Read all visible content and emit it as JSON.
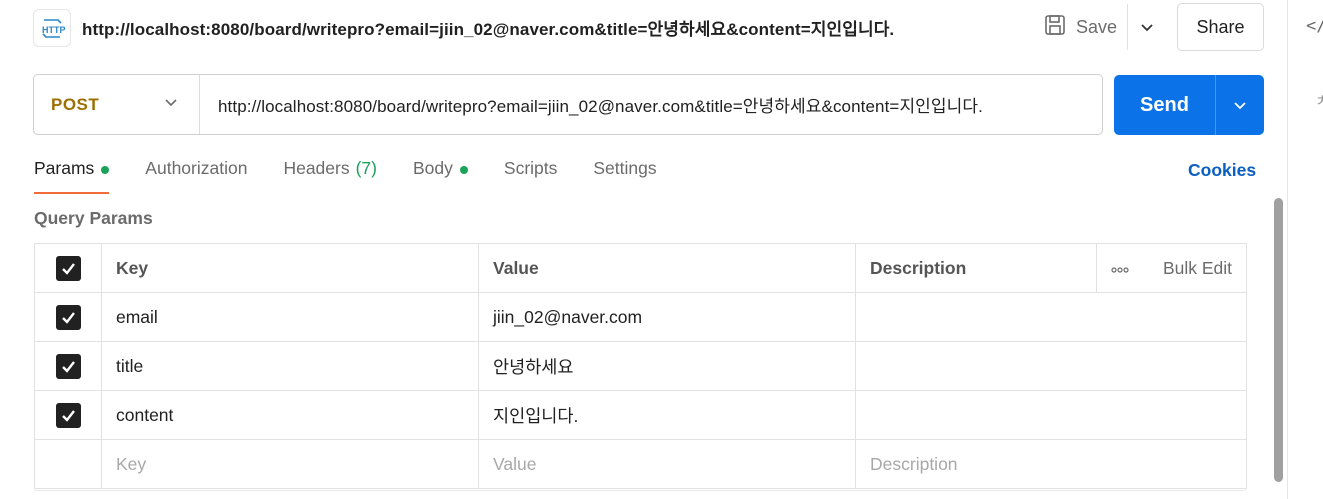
{
  "request": {
    "icon": "http-icon",
    "title": "http://localhost:8080/board/writepro?email=jiin_02@naver.com&title=안녕하세요&content=지인입니다.",
    "save_label": "Save",
    "share_label": "Share"
  },
  "url_bar": {
    "method": "POST",
    "url": "http://localhost:8080/board/writepro?email=jiin_02@naver.com&title=안녕하세요&content=지인입니다.",
    "send_label": "Send"
  },
  "tabs": [
    {
      "label": "Params",
      "active": true,
      "dot": true
    },
    {
      "label": "Authorization"
    },
    {
      "label": "Headers",
      "count": "(7)"
    },
    {
      "label": "Body",
      "dot": true
    },
    {
      "label": "Scripts"
    },
    {
      "label": "Settings"
    }
  ],
  "cookies_label": "Cookies",
  "query_params": {
    "title": "Query Params",
    "headers": {
      "key": "Key",
      "value": "Value",
      "description": "Description",
      "bulk_edit": "Bulk Edit"
    },
    "rows": [
      {
        "checked": true,
        "key": "email",
        "value": "jiin_02@naver.com",
        "description": ""
      },
      {
        "checked": true,
        "key": "title",
        "value": "안녕하세요",
        "description": ""
      },
      {
        "checked": true,
        "key": "content",
        "value": "지인입니다.",
        "description": ""
      }
    ],
    "placeholder": {
      "key": "Key",
      "value": "Value",
      "description": "Description"
    }
  },
  "right_panel": {
    "glyph_top": "</",
    "glyph_second": "ㅊ"
  },
  "colors": {
    "method": "#9e6f00",
    "send": "#0b72e7",
    "active_tab_underline": "#f26b3a",
    "dot": "#19a25a",
    "cookies": "#0b5fc4"
  }
}
